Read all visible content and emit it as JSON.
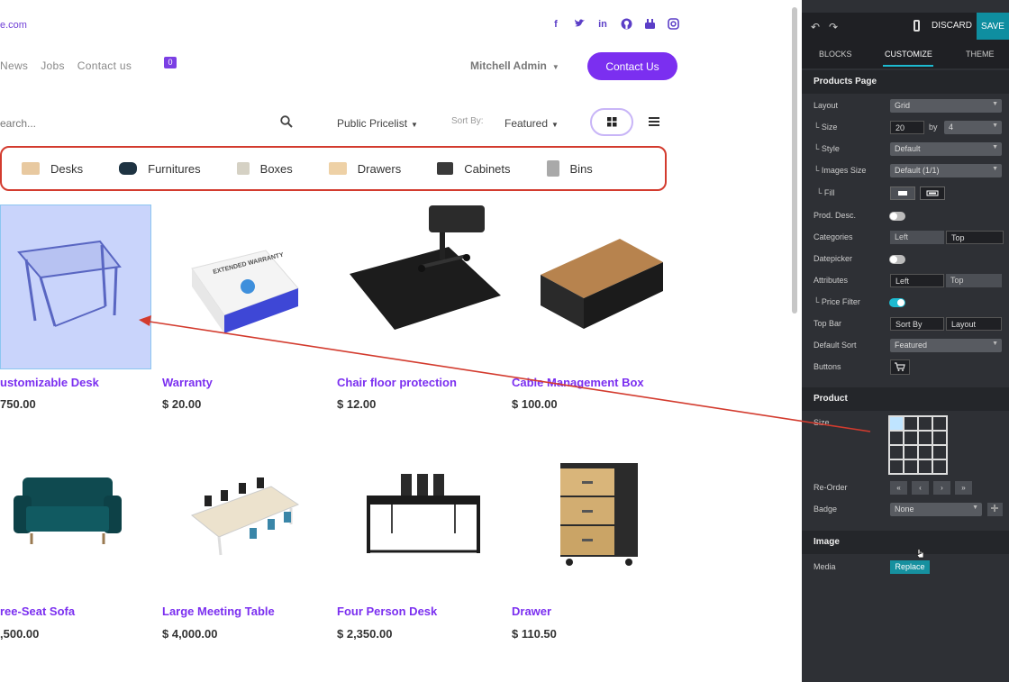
{
  "site": {
    "domain": "e.com",
    "socials": [
      "facebook-icon",
      "twitter-icon",
      "linkedin-icon",
      "github-icon",
      "youtube-icon",
      "instagram-icon"
    ],
    "nav": [
      "News",
      "Jobs",
      "Contact us"
    ],
    "cart_count": "0",
    "user": "Mitchell Admin",
    "contact_button": "Contact Us",
    "search_placeholder": "earch...",
    "pricelist": "Public Pricelist",
    "sort_label": "Sort By:",
    "sort_value": "Featured",
    "categories": [
      {
        "label": "Desks",
        "icon": "desk-icon",
        "color": "#e8c9a0"
      },
      {
        "label": "Furnitures",
        "icon": "sofa-icon",
        "color": "#1e3342"
      },
      {
        "label": "Boxes",
        "icon": "box-icon",
        "color": "#d5d1c4"
      },
      {
        "label": "Drawers",
        "icon": "drawer-icon",
        "color": "#eed1a6"
      },
      {
        "label": "Cabinets",
        "icon": "cabinet-icon",
        "color": "#3a3a3a"
      },
      {
        "label": "Bins",
        "icon": "bin-icon",
        "color": "#a9a9a9"
      }
    ],
    "products": [
      {
        "name": "ustomizable Desk",
        "price": "750.00"
      },
      {
        "name": "Warranty",
        "price": "$ 20.00"
      },
      {
        "name": "Chair floor protection",
        "price": "$ 12.00"
      },
      {
        "name": "Cable Management Box",
        "price": "$ 100.00"
      },
      {
        "name": "ree-Seat Sofa",
        "price": ",500.00"
      },
      {
        "name": "Large Meeting Table",
        "price": "$ 4,000.00"
      },
      {
        "name": "Four Person Desk",
        "price": "$ 2,350.00"
      },
      {
        "name": "Drawer",
        "price": "$ 110.50"
      }
    ],
    "warranty_box_text": "EXTENDED WARRANTY"
  },
  "panel": {
    "discard": "DISCARD",
    "save": "SAVE",
    "tabs": [
      "BLOCKS",
      "CUSTOMIZE",
      "THEME"
    ],
    "products_page": {
      "title": "Products Page",
      "layout_label": "Layout",
      "layout_value": "Grid",
      "size_label": "└ Size",
      "size_value": "20",
      "size_by": "by",
      "size_cols": "4",
      "style_label": "└ Style",
      "style_value": "Default",
      "images_size_label": "└ Images Size",
      "images_size_value": "Default (1/1)",
      "fill_label": "└ Fill",
      "prod_desc_label": "Prod. Desc.",
      "categories_label": "Categories",
      "categories_left": "Left",
      "categories_top": "Top",
      "datepicker_label": "Datepicker",
      "attributes_label": "Attributes",
      "attributes_left": "Left",
      "attributes_top": "Top",
      "price_filter_label": "└ Price Filter",
      "top_bar_label": "Top Bar",
      "top_bar_sort": "Sort By",
      "top_bar_layout": "Layout",
      "default_sort_label": "Default Sort",
      "default_sort_value": "Featured",
      "buttons_label": "Buttons"
    },
    "product": {
      "title": "Product",
      "size_label": "Size",
      "reorder_label": "Re-Order",
      "reorder_buttons": [
        "«",
        "‹",
        "›",
        "»"
      ],
      "badge_label": "Badge",
      "badge_value": "None"
    },
    "image": {
      "title": "Image",
      "media_label": "Media",
      "replace": "Replace"
    },
    "accent": "#1dbad0"
  }
}
